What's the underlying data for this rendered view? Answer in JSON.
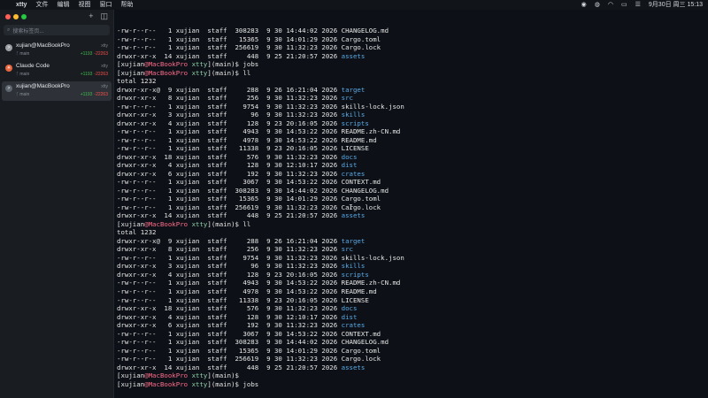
{
  "menubar": {
    "apple": "",
    "app": "xtty",
    "menus": [
      "文件",
      "编辑",
      "视图",
      "窗口",
      "帮助"
    ],
    "datetime": "9月30日 周三  15:13"
  },
  "sidebar": {
    "search_placeholder": "搜索标签页...",
    "sessions": [
      {
        "title": "xujian@MacBookPro",
        "app": "xtty",
        "branch": "main",
        "added": "+1193",
        "removed": "-22263",
        "avatar_color": "#9aa0a6",
        "active": false
      },
      {
        "title": "Claude Code",
        "app": "xtty",
        "branch": "main",
        "added": "+1193",
        "removed": "-22263",
        "avatar_color": "#e8663d",
        "active": false
      },
      {
        "title": "xujian@MacBookPro",
        "app": "xtty",
        "branch": "main",
        "added": "+1193",
        "removed": "-22263",
        "avatar_color": "#5f6670",
        "active": true
      }
    ]
  },
  "terminal": {
    "lines": [
      [
        {
          "t": "-rw-r--r--   1 xujian  staff  308283  9 30 14:44:02 2026 CHANGELOG.md"
        }
      ],
      [
        {
          "t": "-rw-r--r--   1 xujian  staff   15365  9 30 14:01:29 2026 Cargo.toml"
        }
      ],
      [
        {
          "t": "-rw-r--r--   1 xujian  staff  256619  9 30 11:32:23 2026 Cargo.lock"
        }
      ],
      [
        {
          "t": "drwxr-xr-x  14 xujian  staff     448  9 25 21:20:57 2026 "
        },
        {
          "t": "assets",
          "c": "dir"
        }
      ],
      [
        {
          "t": "[xujian"
        },
        {
          "t": "@MacBookPro",
          "c": "host"
        },
        {
          "t": " "
        },
        {
          "t": "xtty",
          "c": "app-c"
        },
        {
          "t": "](main)$ jobs"
        }
      ],
      [
        {
          "t": "[xujian"
        },
        {
          "t": "@MacBookPro",
          "c": "host"
        },
        {
          "t": " "
        },
        {
          "t": "xtty",
          "c": "app-c"
        },
        {
          "t": "](main)$ ll"
        }
      ],
      [
        {
          "t": "total 1232"
        }
      ],
      [
        {
          "t": "drwxr-xr-x@  9 xujian  staff     288  9 26 16:21:04 2026 "
        },
        {
          "t": "target",
          "c": "dir"
        }
      ],
      [
        {
          "t": "drwxr-xr-x   8 xujian  staff     256  9 30 11:32:23 2026 "
        },
        {
          "t": "src",
          "c": "dir"
        }
      ],
      [
        {
          "t": "-rw-r--r--   1 xujian  staff    9754  9 30 11:32:23 2026 skills-lock.json"
        }
      ],
      [
        {
          "t": "drwxr-xr-x   3 xujian  staff      96  9 30 11:32:23 2026 "
        },
        {
          "t": "skills",
          "c": "dir"
        }
      ],
      [
        {
          "t": "drwxr-xr-x   4 xujian  staff     128  9 23 20:16:05 2026 "
        },
        {
          "t": "scripts",
          "c": "dir"
        }
      ],
      [
        {
          "t": "-rw-r--r--   1 xujian  staff    4943  9 30 14:53:22 2026 README.zh-CN.md"
        }
      ],
      [
        {
          "t": "-rw-r--r--   1 xujian  staff    4978  9 30 14:53:22 2026 README.md"
        }
      ],
      [
        {
          "t": "-rw-r--r--   1 xujian  staff   11338  9 23 20:16:05 2026 LICENSE"
        }
      ],
      [
        {
          "t": "drwxr-xr-x  18 xujian  staff     576  9 30 11:32:23 2026 "
        },
        {
          "t": "docs",
          "c": "dir"
        }
      ],
      [
        {
          "t": "drwxr-xr-x   4 xujian  staff     128  9 30 12:10:17 2026 "
        },
        {
          "t": "dist",
          "c": "dir"
        }
      ],
      [
        {
          "t": "drwxr-xr-x   6 xujian  staff     192  9 30 11:32:23 2026 "
        },
        {
          "t": "crates",
          "c": "dir"
        }
      ],
      [
        {
          "t": "-rw-r--r--   1 xujian  staff    3067  9 30 14:53:22 2026 CONTEXT.md"
        }
      ],
      [
        {
          "t": "-rw-r--r--   1 xujian  staff  308283  9 30 14:44:02 2026 CHANGELOG.md"
        }
      ],
      [
        {
          "t": "-rw-r--r--   1 xujian  staff   15365  9 30 14:01:29 2026 Cargo.toml"
        }
      ],
      [
        {
          "t": "-rw-r--r--   1 xujian  staff  256619  9 30 11:32:23 2026 Cargo.lock"
        }
      ],
      [
        {
          "t": "drwxr-xr-x  14 xujian  staff     448  9 25 21:20:57 2026 "
        },
        {
          "t": "assets",
          "c": "dir"
        }
      ],
      [
        {
          "t": "[xujian"
        },
        {
          "t": "@MacBookPro",
          "c": "host"
        },
        {
          "t": " "
        },
        {
          "t": "xtty",
          "c": "app-c"
        },
        {
          "t": "](main)$ ll"
        }
      ],
      [
        {
          "t": "total 1232"
        }
      ],
      [
        {
          "t": "drwxr-xr-x@  9 xujian  staff     288  9 26 16:21:04 2026 "
        },
        {
          "t": "target",
          "c": "dir"
        }
      ],
      [
        {
          "t": "drwxr-xr-x   8 xujian  staff     256  9 30 11:32:23 2026 "
        },
        {
          "t": "src",
          "c": "dir"
        }
      ],
      [
        {
          "t": "-rw-r--r--   1 xujian  staff    9754  9 30 11:32:23 2026 skills-lock.json"
        }
      ],
      [
        {
          "t": "drwxr-xr-x   3 xujian  staff      96  9 30 11:32:23 2026 "
        },
        {
          "t": "skills",
          "c": "dir"
        }
      ],
      [
        {
          "t": "drwxr-xr-x   4 xujian  staff     128  9 23 20:16:05 2026 "
        },
        {
          "t": "scripts",
          "c": "dir"
        }
      ],
      [
        {
          "t": "-rw-r--r--   1 xujian  staff    4943  9 30 14:53:22 2026 README.zh-CN.md"
        }
      ],
      [
        {
          "t": "-rw-r--r--   1 xujian  staff    4978  9 30 14:53:22 2026 README.md"
        }
      ],
      [
        {
          "t": "-rw-r--r--   1 xujian  staff   11338  9 23 20:16:05 2026 LICENSE"
        }
      ],
      [
        {
          "t": "drwxr-xr-x  18 xujian  staff     576  9 30 11:32:23 2026 "
        },
        {
          "t": "docs",
          "c": "dir"
        }
      ],
      [
        {
          "t": "drwxr-xr-x   4 xujian  staff     128  9 30 12:10:17 2026 "
        },
        {
          "t": "dist",
          "c": "dir"
        }
      ],
      [
        {
          "t": "drwxr-xr-x   6 xujian  staff     192  9 30 11:32:23 2026 "
        },
        {
          "t": "crates",
          "c": "dir"
        }
      ],
      [
        {
          "t": "-rw-r--r--   1 xujian  staff    3067  9 30 14:53:22 2026 CONTEXT.md"
        }
      ],
      [
        {
          "t": "-rw-r--r--   1 xujian  staff  308283  9 30 14:44:02 2026 CHANGELOG.md"
        }
      ],
      [
        {
          "t": "-rw-r--r--   1 xujian  staff   15365  9 30 14:01:29 2026 Cargo.toml"
        }
      ],
      [
        {
          "t": "-rw-r--r--   1 xujian  staff  256619  9 30 11:32:23 2026 Cargo.lock"
        }
      ],
      [
        {
          "t": "drwxr-xr-x  14 xujian  staff     448  9 25 21:20:57 2026 "
        },
        {
          "t": "assets",
          "c": "dir"
        }
      ],
      [
        {
          "t": "[xujian"
        },
        {
          "t": "@MacBookPro",
          "c": "host"
        },
        {
          "t": " "
        },
        {
          "t": "xtty",
          "c": "app-c"
        },
        {
          "t": "](main)$"
        }
      ],
      [
        {
          "t": "[xujian"
        },
        {
          "t": "@MacBookPro",
          "c": "host"
        },
        {
          "t": " "
        },
        {
          "t": "xtty",
          "c": "app-c"
        },
        {
          "t": "](main)$ jobs"
        }
      ]
    ]
  },
  "colors": {
    "dir": "#5aa9e6",
    "host": "#ff6b8a",
    "app": "#8fd0a8",
    "diff_added": "#3fb950",
    "diff_removed": "#f85149"
  }
}
